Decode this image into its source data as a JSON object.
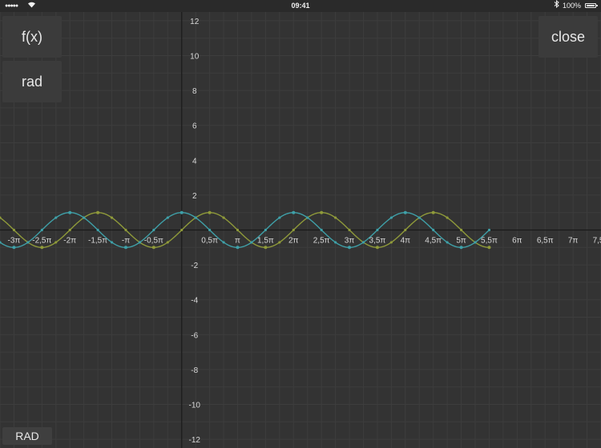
{
  "status_bar": {
    "signal": "●●●●●",
    "wifi_icon": "wifi-icon",
    "time": "09:41",
    "bluetooth_icon": "bluetooth-icon",
    "battery": "100%"
  },
  "controls": {
    "function_label": "f(x)",
    "angle_label": "rad",
    "close_label": "close",
    "mode_label": "RAD"
  },
  "colors": {
    "background": "#333333",
    "grid": "#3d3d3d",
    "axis": "#1a1a1a",
    "series_sin": "#8f9a3a",
    "series_cos": "#3fa0a8"
  },
  "chart_data": {
    "type": "line",
    "x_axis_unit": "π",
    "xlim": [
      -3.25,
      7.5
    ],
    "ylim": [
      -12.5,
      12.5
    ],
    "x_ticks": [
      -3,
      -2.5,
      -2,
      -1.5,
      -1,
      -0.5,
      0.5,
      1,
      1.5,
      2,
      2.5,
      3,
      3.5,
      4,
      4.5,
      5,
      5.5,
      6,
      6.5,
      7,
      7.5
    ],
    "x_tick_labels": [
      "-3π",
      "-2,5π",
      "-2π",
      "-1,5π",
      "-π",
      "-0,5π",
      "0,5π",
      "π",
      "1,5π",
      "2π",
      "2,5π",
      "3π",
      "3,5π",
      "4π",
      "4,5π",
      "5π",
      "5,5π",
      "6π",
      "6,5π",
      "7π",
      "7,5π"
    ],
    "y_ticks": [
      12,
      10,
      8,
      6,
      4,
      2,
      -2,
      -4,
      -6,
      -8,
      -10,
      -12
    ],
    "y_tick_labels": [
      "12",
      "10",
      "8",
      "6",
      "4",
      "2",
      "-2",
      "-4",
      "-6",
      "-8",
      "-10",
      "-12"
    ],
    "grid": true,
    "series": [
      {
        "function": "sin",
        "amplitude": 1,
        "x_range": [
          -3.25,
          5.5
        ]
      },
      {
        "function": "cos",
        "amplitude": 1,
        "x_range": [
          -3.25,
          5.5
        ]
      }
    ]
  }
}
